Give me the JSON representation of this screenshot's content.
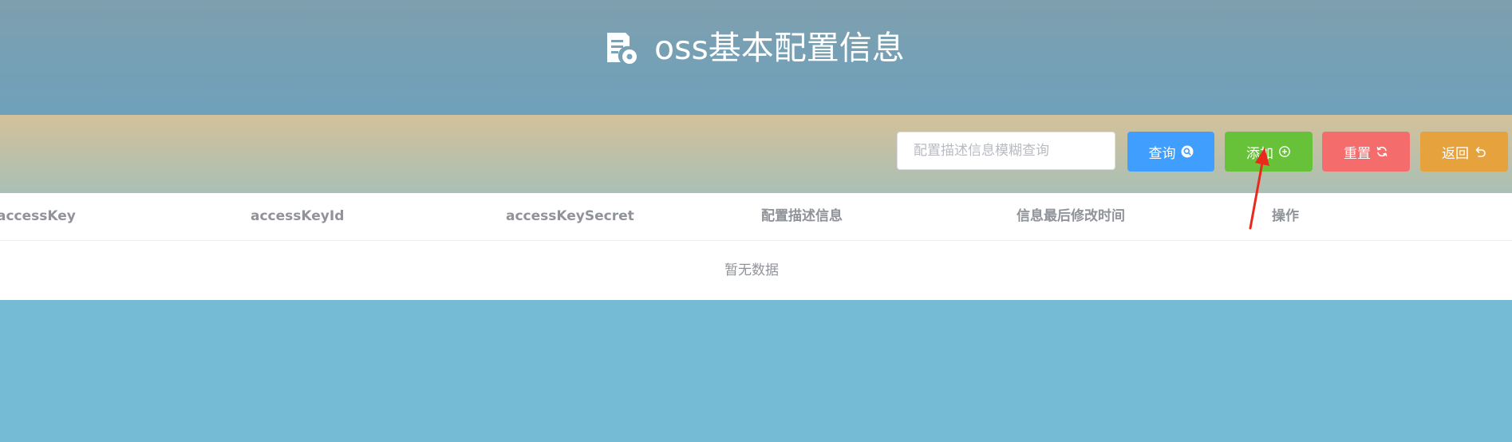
{
  "header": {
    "title": "oss基本配置信息",
    "icon": "document-gear-icon"
  },
  "toolbar": {
    "search": {
      "placeholder": "配置描述信息模糊查询",
      "value": ""
    },
    "buttons": {
      "query": {
        "label": "查询",
        "icon": "search-icon",
        "color": "#409eff"
      },
      "add": {
        "label": "添加",
        "icon": "plus-circle-icon",
        "color": "#67c23a"
      },
      "reset": {
        "label": "重置",
        "icon": "refresh-icon",
        "color": "#f56c6c"
      },
      "back": {
        "label": "返回",
        "icon": "undo-icon",
        "color": "#e6a23c"
      }
    }
  },
  "table": {
    "columns": [
      "accessKey",
      "accessKeyId",
      "accessKeySecret",
      "配置描述信息",
      "信息最后修改时间",
      "操作"
    ],
    "rows": [],
    "empty_text": "暂无数据"
  },
  "annotation": {
    "icon": "red-arrow-icon",
    "color": "#e8291c"
  },
  "colors": {
    "header_top": "#7e9fae",
    "header_bottom": "#6fa1bb",
    "toolbar_top": "#d4c19a",
    "toolbar_bottom": "#a9c0b5",
    "page_background": "#75bbd5"
  }
}
